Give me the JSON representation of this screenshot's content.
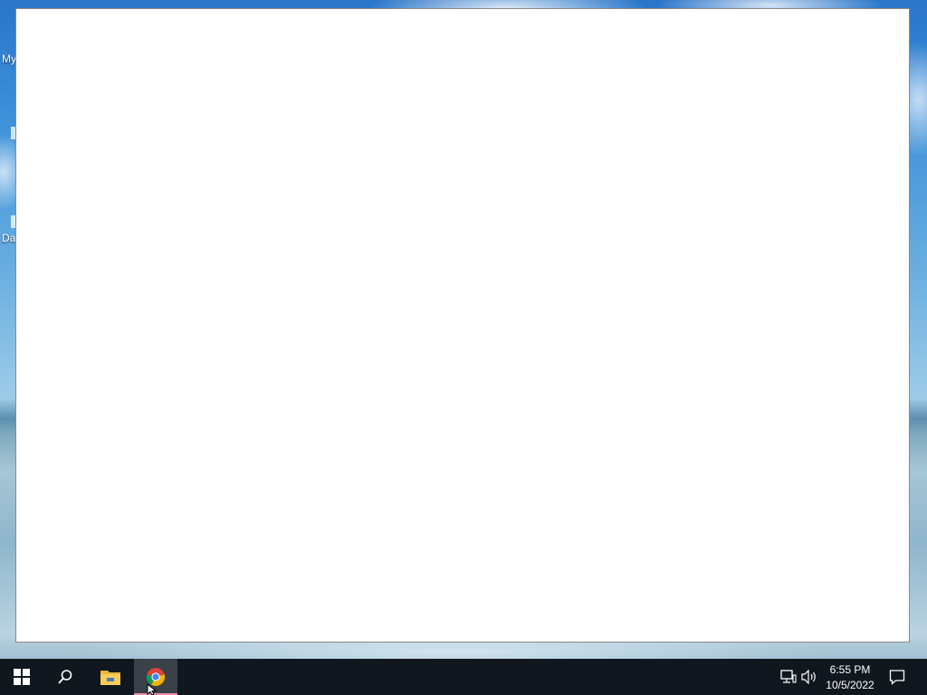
{
  "desktop": {
    "icons": [
      {
        "label": "My"
      },
      {
        "label": "Da"
      }
    ]
  },
  "window": {
    "content": ""
  },
  "taskbar": {
    "start_icon": "windows-logo-icon",
    "search_icon": "search-icon",
    "pinned_apps": [
      {
        "name": "File Explorer",
        "icon": "folder-icon",
        "active": false
      },
      {
        "name": "Google Chrome",
        "icon": "chrome-icon",
        "active": true
      }
    ],
    "tray": {
      "network_icon": "network-icon",
      "volume_icon": "volume-icon",
      "notification_icon": "notification-icon"
    },
    "clock": {
      "time": "6:55 PM",
      "date": "10/5/2022"
    }
  },
  "colors": {
    "taskbar_bg": "#10171f",
    "active_app_indicator": "#f08aa6",
    "window_bg": "#ffffff"
  }
}
